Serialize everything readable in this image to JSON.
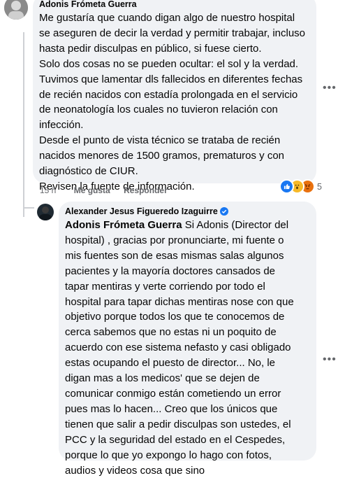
{
  "comment1": {
    "author": "Adonis Frómeta Guerra",
    "paragraphs": [
      "Me gustaría que cuando digan algo de nuestro hospital se aseguren de decir la verdad y permitir trabajar, incluso hasta pedir disculpas en público, si fuese cierto.",
      "Solo dos cosas no se pueden ocultar: el sol y la verdad.",
      "Tuvimos que lamentar dls fallecidos en diferentes fechas de recién nacidos con estadía prolongada en el servicio de neonatología los cuales no tuvieron relación con infección.",
      "Desde el punto de vista técnico se trataba de recién nacidos menores de 1500 gramos, prematuros y con diagnóstico de CIUR.",
      "Revisen la fuente de información."
    ],
    "time": "15 h",
    "like_label": "Me gusta",
    "reply_label": "Responder",
    "reaction_count": "5",
    "reactions": [
      "like-icon",
      "wow-icon",
      "angry-icon"
    ],
    "more_label": "•••"
  },
  "comment2": {
    "author": "Alexander Jesus Figueredo Izaguirre",
    "verified": "verified-badge-icon",
    "mention": "Adonis Frómeta Guerra",
    "body": " Si Adonis (Director del hospital) , gracias por pronunciarte, mi fuente o mis fuentes son de esas mismas salas algunos pacientes y la mayoría doctores cansados de tapar mentiras y verte corriendo por todo el hospital para tapar dichas mentiras nose con que objetivo porque todos los que te conocemos de cerca sabemos que no estas ni un poquito de acuerdo con ese sistema nefasto y casi obligado estas ocupando el puesto de director... No, le digan mas a los medicos' que se dejen de comunicar conmigo están cometiendo un error pues mas lo hacen... Creo que los únicos que tienen que salir a pedir disculpas son ustedes, el PCC y la seguridad del estado en el Cespedes, porque lo que yo expongo lo hago con fotos, audios y videos cosa que sino",
    "more_label": "•••"
  },
  "colors": {
    "accent": "#1877f2",
    "bubble": "#f0f2f5",
    "secondary": "#65676b"
  }
}
